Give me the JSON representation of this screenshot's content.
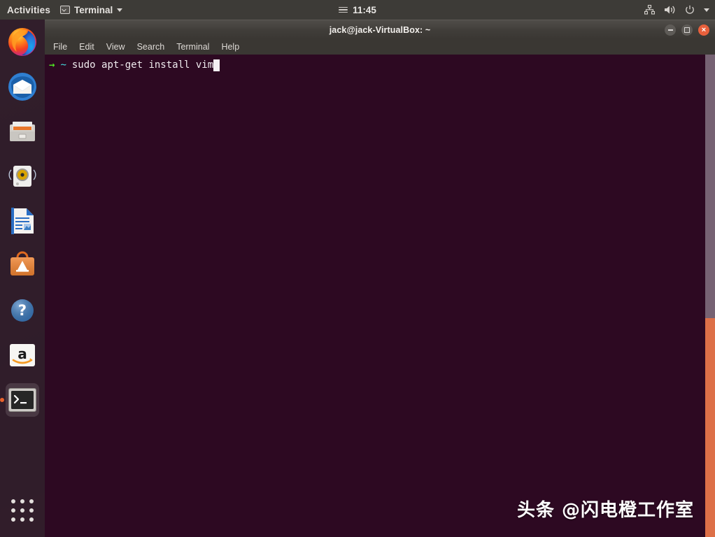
{
  "topbar": {
    "activities": "Activities",
    "app_name": "Terminal",
    "clock": "11:45",
    "icons": {
      "app": "terminal-icon",
      "app_caret": "chevron-down-icon",
      "calendar": "hamburger-menu-icon",
      "network": "network-icon",
      "volume": "volume-icon",
      "power": "power-icon",
      "system_caret": "chevron-down-icon"
    }
  },
  "dock": {
    "items": [
      {
        "name": "firefox",
        "label": "Firefox Web Browser",
        "running": false
      },
      {
        "name": "thunderbird",
        "label": "Thunderbird Mail",
        "running": false
      },
      {
        "name": "files",
        "label": "Files",
        "running": false
      },
      {
        "name": "rhythmbox",
        "label": "Rhythmbox",
        "running": false
      },
      {
        "name": "libreoffice-writer",
        "label": "LibreOffice Writer",
        "running": false
      },
      {
        "name": "ubuntu-software",
        "label": "Ubuntu Software",
        "running": false
      },
      {
        "name": "help",
        "label": "Help",
        "running": false
      },
      {
        "name": "amazon",
        "label": "Amazon",
        "running": false
      },
      {
        "name": "terminal",
        "label": "Terminal",
        "running": true
      }
    ],
    "show_apps_label": "Show Applications"
  },
  "terminal": {
    "title": "jack@jack-VirtualBox: ~",
    "menu": [
      "File",
      "Edit",
      "View",
      "Search",
      "Terminal",
      "Help"
    ],
    "window_buttons": {
      "minimize": "minimize-button",
      "maximize": "maximize-button",
      "close": "×"
    },
    "prompt": {
      "arrow": "→",
      "path": "~"
    },
    "command": "sudo apt-get install vim"
  },
  "watermark": {
    "text": "头条 @闪电橙工作室"
  },
  "colors": {
    "topbar_bg": "#3d3b37",
    "dock_bg": "#301e2a",
    "terminal_bg": "#2d0922",
    "prompt_green": "#4fe024",
    "prompt_cyan": "#44dde0",
    "close_button": "#e8603c",
    "scrollbar": "#766273",
    "accent_orange": "#dd7048"
  }
}
